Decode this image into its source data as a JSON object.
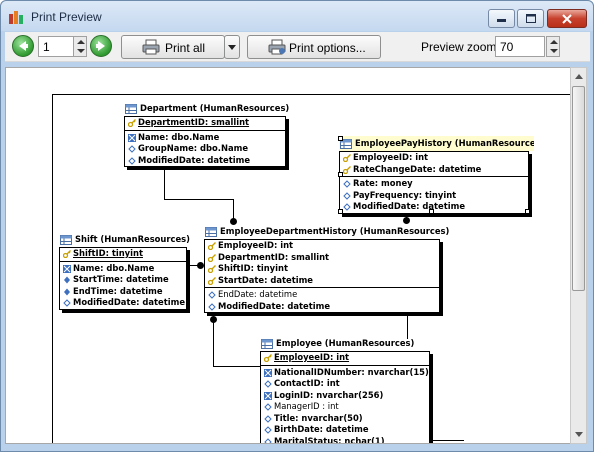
{
  "window": {
    "title": "Print Preview",
    "buttons": {
      "minimize": "minimize",
      "maximize": "maximize",
      "close": "close"
    }
  },
  "toolbar": {
    "page_value": "1",
    "print_all_label": "Print all",
    "print_options_label": "Print options...",
    "zoom_label": "Preview zoom",
    "zoom_value": "70"
  },
  "diagram": {
    "tables": [
      {
        "title": "Department (HumanResources)",
        "rows": [
          {
            "text": "DepartmentID: smallint",
            "kind": "pk"
          },
          {
            "text": "Name: dbo.Name",
            "kind": "idx"
          },
          {
            "text": "GroupName: dbo.Name",
            "kind": "col"
          },
          {
            "text": "ModifiedDate: datetime",
            "kind": "col"
          }
        ]
      },
      {
        "title": "EmployeePayHistory (HumanResource",
        "rows": [
          {
            "text": "EmployeeID: int",
            "kind": "fk"
          },
          {
            "text": "RateChangeDate: datetime",
            "kind": "fk"
          },
          {
            "text": "Rate: money",
            "kind": "col"
          },
          {
            "text": "PayFrequency: tinyint",
            "kind": "col"
          },
          {
            "text": "ModifiedDate: datetime",
            "kind": "col"
          }
        ]
      },
      {
        "title": "Shift (HumanResources)",
        "rows": [
          {
            "text": "ShiftID: tinyint",
            "kind": "pk"
          },
          {
            "text": "Name: dbo.Name",
            "kind": "idx"
          },
          {
            "text": "StartTime: datetime",
            "kind": "idx2"
          },
          {
            "text": "EndTime: datetime",
            "kind": "idx2"
          },
          {
            "text": "ModifiedDate: datetime",
            "kind": "col"
          }
        ]
      },
      {
        "title": "EmployeeDepartmentHistory (HumanResources)",
        "rows": [
          {
            "text": "EmployeeID: int",
            "kind": "fk"
          },
          {
            "text": "DepartmentID: smallint",
            "kind": "fk"
          },
          {
            "text": "ShiftID: tinyint",
            "kind": "fk"
          },
          {
            "text": "StartDate: datetime",
            "kind": "fk"
          },
          {
            "text": "EndDate: datetime",
            "kind": "colnb"
          },
          {
            "text": "ModifiedDate: datetime",
            "kind": "col"
          }
        ]
      },
      {
        "title": "Employee (HumanResources)",
        "rows": [
          {
            "text": "EmployeeID: int",
            "kind": "pk"
          },
          {
            "text": "NationalIDNumber: nvarchar(15)",
            "kind": "idx"
          },
          {
            "text": "ContactID: int",
            "kind": "col"
          },
          {
            "text": "LoginID: nvarchar(256)",
            "kind": "idx"
          },
          {
            "text": "ManagerID : int",
            "kind": "colnb"
          },
          {
            "text": "Title: nvarchar(50)",
            "kind": "col"
          },
          {
            "text": "BirthDate: datetime",
            "kind": "col"
          },
          {
            "text": "MaritalStatus: nchar(1)",
            "kind": "col"
          }
        ]
      }
    ]
  },
  "colors": {
    "accent_green": "#2f9a2f",
    "selection_yellow": "#fffdd0",
    "frame_blue": "#b9d1ea"
  }
}
